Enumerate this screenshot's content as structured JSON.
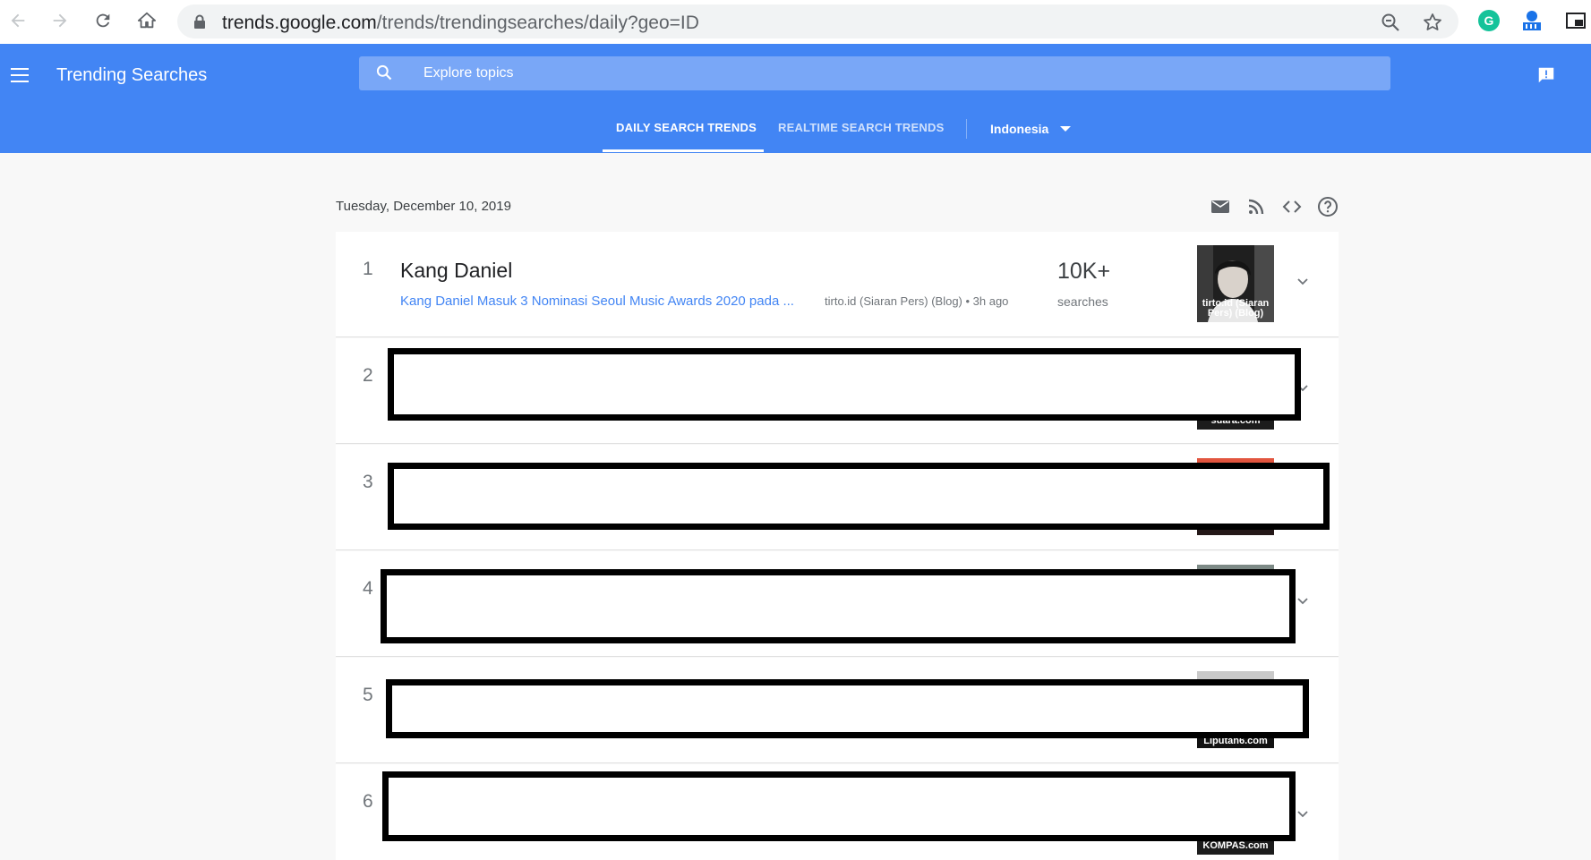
{
  "browser": {
    "url_host": "trends.google.com",
    "url_path": "/trends/trendingsearches/daily?geo=ID"
  },
  "header": {
    "app_title": "Trending Searches",
    "search_placeholder": "Explore topics",
    "tabs": [
      {
        "label": "DAILY SEARCH TRENDS",
        "active": true
      },
      {
        "label": "REALTIME SEARCH TRENDS",
        "active": false
      }
    ],
    "country": "Indonesia"
  },
  "date": "Tuesday, December 10, 2019",
  "trends": [
    {
      "rank": "1",
      "title": "Kang Daniel",
      "article": "Kang Daniel Masuk 3 Nominasi Seoul Music Awards 2020 pada ...",
      "source": "tirto.id (Siaran Pers) (Blog) • 3h ago",
      "count": "10K+",
      "count_label": "searches",
      "thumb_caption_1": "tirto.id (Siaran",
      "thumb_caption_2": "Pers) (Blog)"
    },
    {
      "rank": "2",
      "thumb_caption": "suara.com"
    },
    {
      "rank": "3"
    },
    {
      "rank": "4"
    },
    {
      "rank": "5",
      "thumb_caption": "Liputan6.com"
    },
    {
      "rank": "6",
      "thumb_caption": "KOMPAS.com"
    }
  ],
  "colors": {
    "brand_blue": "#4285f4",
    "search_bg": "#79a7f7",
    "link_blue": "#4285f4"
  }
}
